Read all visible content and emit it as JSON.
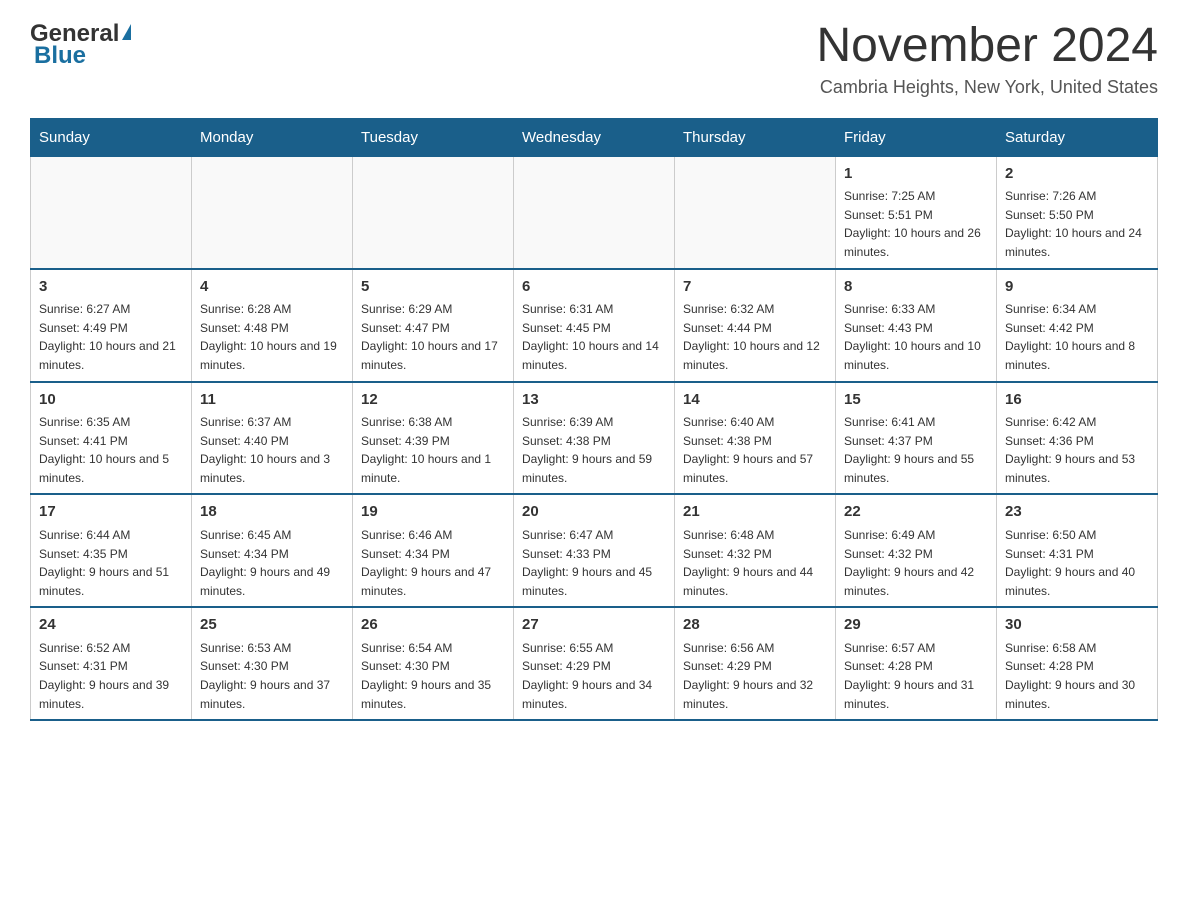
{
  "header": {
    "logo_general": "General",
    "logo_blue": "Blue",
    "month_title": "November 2024",
    "location": "Cambria Heights, New York, United States"
  },
  "days_of_week": [
    "Sunday",
    "Monday",
    "Tuesday",
    "Wednesday",
    "Thursday",
    "Friday",
    "Saturday"
  ],
  "weeks": [
    [
      {
        "day": "",
        "info": ""
      },
      {
        "day": "",
        "info": ""
      },
      {
        "day": "",
        "info": ""
      },
      {
        "day": "",
        "info": ""
      },
      {
        "day": "",
        "info": ""
      },
      {
        "day": "1",
        "info": "Sunrise: 7:25 AM\nSunset: 5:51 PM\nDaylight: 10 hours and 26 minutes."
      },
      {
        "day": "2",
        "info": "Sunrise: 7:26 AM\nSunset: 5:50 PM\nDaylight: 10 hours and 24 minutes."
      }
    ],
    [
      {
        "day": "3",
        "info": "Sunrise: 6:27 AM\nSunset: 4:49 PM\nDaylight: 10 hours and 21 minutes."
      },
      {
        "day": "4",
        "info": "Sunrise: 6:28 AM\nSunset: 4:48 PM\nDaylight: 10 hours and 19 minutes."
      },
      {
        "day": "5",
        "info": "Sunrise: 6:29 AM\nSunset: 4:47 PM\nDaylight: 10 hours and 17 minutes."
      },
      {
        "day": "6",
        "info": "Sunrise: 6:31 AM\nSunset: 4:45 PM\nDaylight: 10 hours and 14 minutes."
      },
      {
        "day": "7",
        "info": "Sunrise: 6:32 AM\nSunset: 4:44 PM\nDaylight: 10 hours and 12 minutes."
      },
      {
        "day": "8",
        "info": "Sunrise: 6:33 AM\nSunset: 4:43 PM\nDaylight: 10 hours and 10 minutes."
      },
      {
        "day": "9",
        "info": "Sunrise: 6:34 AM\nSunset: 4:42 PM\nDaylight: 10 hours and 8 minutes."
      }
    ],
    [
      {
        "day": "10",
        "info": "Sunrise: 6:35 AM\nSunset: 4:41 PM\nDaylight: 10 hours and 5 minutes."
      },
      {
        "day": "11",
        "info": "Sunrise: 6:37 AM\nSunset: 4:40 PM\nDaylight: 10 hours and 3 minutes."
      },
      {
        "day": "12",
        "info": "Sunrise: 6:38 AM\nSunset: 4:39 PM\nDaylight: 10 hours and 1 minute."
      },
      {
        "day": "13",
        "info": "Sunrise: 6:39 AM\nSunset: 4:38 PM\nDaylight: 9 hours and 59 minutes."
      },
      {
        "day": "14",
        "info": "Sunrise: 6:40 AM\nSunset: 4:38 PM\nDaylight: 9 hours and 57 minutes."
      },
      {
        "day": "15",
        "info": "Sunrise: 6:41 AM\nSunset: 4:37 PM\nDaylight: 9 hours and 55 minutes."
      },
      {
        "day": "16",
        "info": "Sunrise: 6:42 AM\nSunset: 4:36 PM\nDaylight: 9 hours and 53 minutes."
      }
    ],
    [
      {
        "day": "17",
        "info": "Sunrise: 6:44 AM\nSunset: 4:35 PM\nDaylight: 9 hours and 51 minutes."
      },
      {
        "day": "18",
        "info": "Sunrise: 6:45 AM\nSunset: 4:34 PM\nDaylight: 9 hours and 49 minutes."
      },
      {
        "day": "19",
        "info": "Sunrise: 6:46 AM\nSunset: 4:34 PM\nDaylight: 9 hours and 47 minutes."
      },
      {
        "day": "20",
        "info": "Sunrise: 6:47 AM\nSunset: 4:33 PM\nDaylight: 9 hours and 45 minutes."
      },
      {
        "day": "21",
        "info": "Sunrise: 6:48 AM\nSunset: 4:32 PM\nDaylight: 9 hours and 44 minutes."
      },
      {
        "day": "22",
        "info": "Sunrise: 6:49 AM\nSunset: 4:32 PM\nDaylight: 9 hours and 42 minutes."
      },
      {
        "day": "23",
        "info": "Sunrise: 6:50 AM\nSunset: 4:31 PM\nDaylight: 9 hours and 40 minutes."
      }
    ],
    [
      {
        "day": "24",
        "info": "Sunrise: 6:52 AM\nSunset: 4:31 PM\nDaylight: 9 hours and 39 minutes."
      },
      {
        "day": "25",
        "info": "Sunrise: 6:53 AM\nSunset: 4:30 PM\nDaylight: 9 hours and 37 minutes."
      },
      {
        "day": "26",
        "info": "Sunrise: 6:54 AM\nSunset: 4:30 PM\nDaylight: 9 hours and 35 minutes."
      },
      {
        "day": "27",
        "info": "Sunrise: 6:55 AM\nSunset: 4:29 PM\nDaylight: 9 hours and 34 minutes."
      },
      {
        "day": "28",
        "info": "Sunrise: 6:56 AM\nSunset: 4:29 PM\nDaylight: 9 hours and 32 minutes."
      },
      {
        "day": "29",
        "info": "Sunrise: 6:57 AM\nSunset: 4:28 PM\nDaylight: 9 hours and 31 minutes."
      },
      {
        "day": "30",
        "info": "Sunrise: 6:58 AM\nSunset: 4:28 PM\nDaylight: 9 hours and 30 minutes."
      }
    ]
  ]
}
